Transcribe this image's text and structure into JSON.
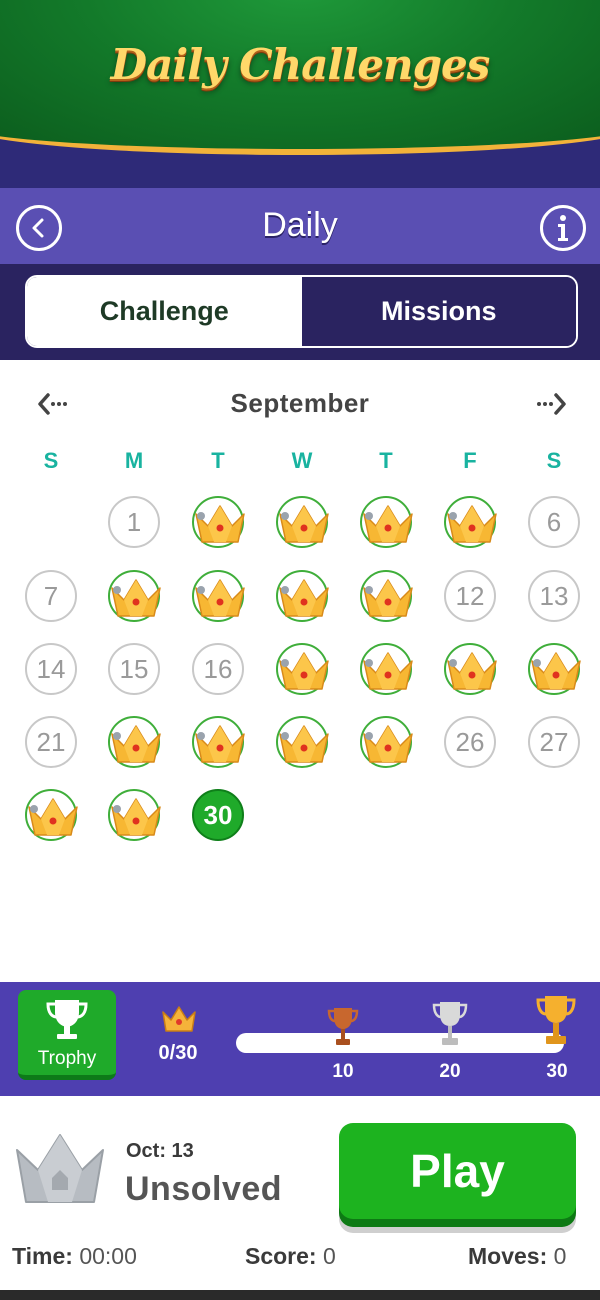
{
  "header": {
    "title": "Daily Challenges"
  },
  "nav": {
    "title": "Daily",
    "back_icon": "chevron-left-icon",
    "info_icon": "info-icon"
  },
  "tabs": [
    {
      "label": "Challenge",
      "active": true
    },
    {
      "label": "Missions",
      "active": false
    }
  ],
  "calendar": {
    "month": "September",
    "weekdays": [
      "S",
      "M",
      "T",
      "W",
      "T",
      "F",
      "S"
    ],
    "days": [
      {
        "day": "1",
        "status": "unplayed"
      },
      {
        "day": "2",
        "status": "crown"
      },
      {
        "day": "3",
        "status": "crown"
      },
      {
        "day": "4",
        "status": "crown"
      },
      {
        "day": "5",
        "status": "crown"
      },
      {
        "day": "6",
        "status": "unplayed"
      },
      {
        "day": "7",
        "status": "unplayed"
      },
      {
        "day": "8",
        "status": "crown"
      },
      {
        "day": "9",
        "status": "crown"
      },
      {
        "day": "10",
        "status": "crown"
      },
      {
        "day": "11",
        "status": "crown"
      },
      {
        "day": "12",
        "status": "unplayed"
      },
      {
        "day": "13",
        "status": "unplayed"
      },
      {
        "day": "14",
        "status": "unplayed"
      },
      {
        "day": "15",
        "status": "unplayed"
      },
      {
        "day": "16",
        "status": "unplayed"
      },
      {
        "day": "17",
        "status": "crown"
      },
      {
        "day": "18",
        "status": "crown"
      },
      {
        "day": "19",
        "status": "crown"
      },
      {
        "day": "20",
        "status": "crown"
      },
      {
        "day": "21",
        "status": "unplayed"
      },
      {
        "day": "22",
        "status": "crown"
      },
      {
        "day": "23",
        "status": "crown"
      },
      {
        "day": "24",
        "status": "crown"
      },
      {
        "day": "25",
        "status": "crown"
      },
      {
        "day": "26",
        "status": "unplayed"
      },
      {
        "day": "27",
        "status": "unplayed"
      },
      {
        "day": "28",
        "status": "crown"
      },
      {
        "day": "29",
        "status": "crown"
      },
      {
        "day": "30",
        "status": "today"
      }
    ]
  },
  "trophy": {
    "button_label": "Trophy",
    "progress_text": "0/30",
    "progress_fraction": 0.0,
    "milestones": [
      {
        "label": "10",
        "tier": "bronze"
      },
      {
        "label": "20",
        "tier": "silver"
      },
      {
        "label": "30",
        "tier": "gold"
      }
    ]
  },
  "selected": {
    "date_label": "Oct: 13",
    "status": "Unsolved",
    "play_label": "Play"
  },
  "stats": {
    "time_label": "Time:",
    "time_value": "00:00",
    "score_label": "Score:",
    "score_value": "0",
    "moves_label": "Moves:",
    "moves_value": "0"
  },
  "colors": {
    "accent_green": "#1faa2a",
    "weekday_teal": "#19b3a0",
    "nav_purple": "#5a4fb3",
    "tab_navy": "#2a2360",
    "crown_gold": "#f5b33a"
  }
}
